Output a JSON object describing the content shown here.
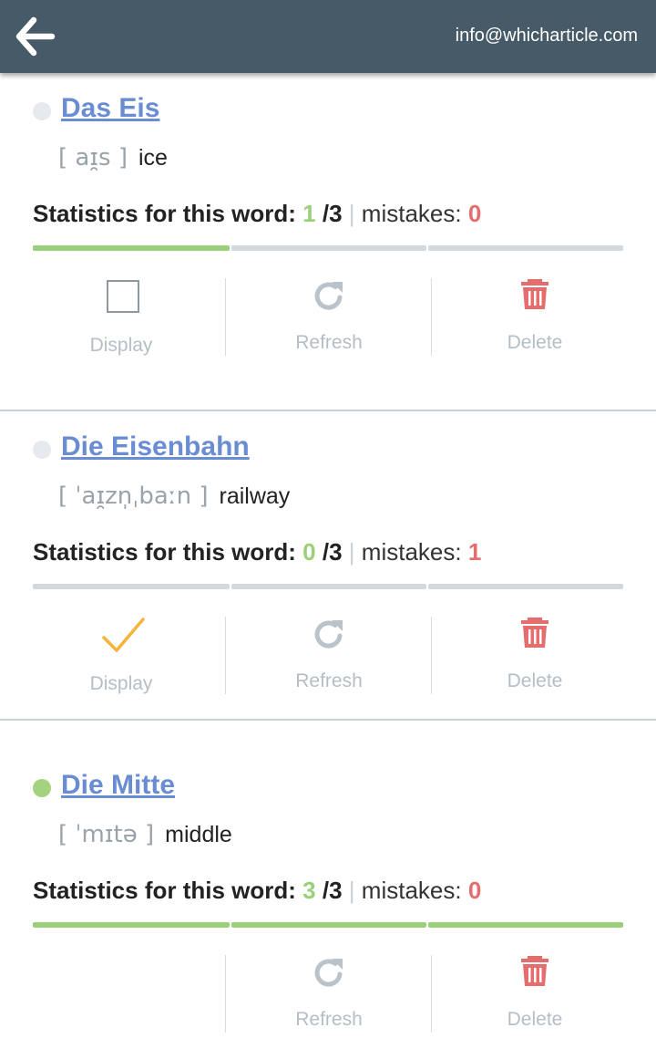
{
  "header": {
    "back_icon": "arrow-left-icon",
    "email": "info@whicharticle.com",
    "background": "#465a68"
  },
  "colors": {
    "accent_link": "#6a8cd3",
    "correct": "#9bd07b",
    "mistake": "#e56d6d",
    "progress_empty": "#d2d9de",
    "muted": "#b4bec4"
  },
  "words": [
    {
      "title": "Das Eis",
      "status_dot": "#e6e9ed",
      "phonetic": "[ aɪ̯s ]",
      "translation": "ice",
      "stats_label": "Statistics for this word:",
      "learned": "1",
      "total": "/3",
      "separator": "|",
      "mistakes_label": "mistakes:",
      "mistakes": "0",
      "progress": 1,
      "display_state": "unchecked",
      "display_label": "Display",
      "refresh_label": "Refresh",
      "delete_label": "Delete"
    },
    {
      "title": "Die Eisenbahn",
      "status_dot": "#e6e9ed",
      "phonetic": "[ ˈaɪ̯zn̩ˌbaːn ]",
      "translation": "railway",
      "stats_label": "Statistics for this word:",
      "learned": "0",
      "total": "/3",
      "separator": "|",
      "mistakes_label": "mistakes:",
      "mistakes": "1",
      "progress": 0,
      "display_state": "checked",
      "display_label": "Display",
      "refresh_label": "Refresh",
      "delete_label": "Delete"
    },
    {
      "title": "Die Mitte",
      "status_dot": "#a5d27f",
      "phonetic": "[ ˈmɪtə ]",
      "translation": "middle",
      "stats_label": "Statistics for this word:",
      "learned": "3",
      "total": "/3",
      "separator": "|",
      "mistakes_label": "mistakes:",
      "mistakes": "0",
      "progress": 3,
      "display_state": "none",
      "display_label": "",
      "refresh_label": "Refresh",
      "delete_label": "Delete"
    }
  ]
}
